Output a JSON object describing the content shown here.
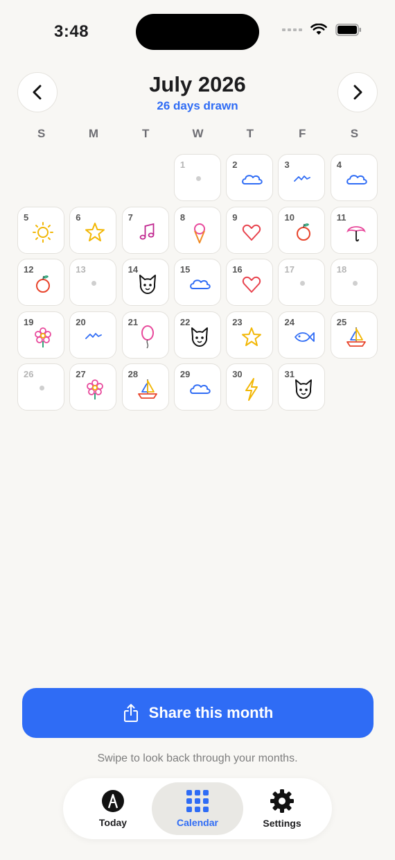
{
  "status": {
    "time": "3:48"
  },
  "header": {
    "title": "July 2026",
    "subtitle": "26 days drawn"
  },
  "weekdays": [
    "S",
    "M",
    "T",
    "W",
    "T",
    "F",
    "S"
  ],
  "calendar": {
    "leading_blanks": 3,
    "days": [
      {
        "n": "1",
        "d": ""
      },
      {
        "n": "2",
        "d": "cloud"
      },
      {
        "n": "3",
        "d": "bird"
      },
      {
        "n": "4",
        "d": "cloud"
      },
      {
        "n": "5",
        "d": "sun"
      },
      {
        "n": "6",
        "d": "star"
      },
      {
        "n": "7",
        "d": "music"
      },
      {
        "n": "8",
        "d": "icecream"
      },
      {
        "n": "9",
        "d": "heart"
      },
      {
        "n": "10",
        "d": "apple"
      },
      {
        "n": "11",
        "d": "umbrella"
      },
      {
        "n": "12",
        "d": "apple"
      },
      {
        "n": "13",
        "d": ""
      },
      {
        "n": "14",
        "d": "cat"
      },
      {
        "n": "15",
        "d": "cloud"
      },
      {
        "n": "16",
        "d": "heart"
      },
      {
        "n": "17",
        "d": ""
      },
      {
        "n": "18",
        "d": ""
      },
      {
        "n": "19",
        "d": "flower"
      },
      {
        "n": "20",
        "d": "bird"
      },
      {
        "n": "21",
        "d": "balloon"
      },
      {
        "n": "22",
        "d": "cat"
      },
      {
        "n": "23",
        "d": "star"
      },
      {
        "n": "24",
        "d": "fish"
      },
      {
        "n": "25",
        "d": "sailboat"
      },
      {
        "n": "26",
        "d": ""
      },
      {
        "n": "27",
        "d": "flower"
      },
      {
        "n": "28",
        "d": "sailboat"
      },
      {
        "n": "29",
        "d": "cloud"
      },
      {
        "n": "30",
        "d": "lightning"
      },
      {
        "n": "31",
        "d": "cat"
      }
    ]
  },
  "share": {
    "label": "Share this month"
  },
  "hint": "Swipe to look back through your months.",
  "tabs": {
    "today": "Today",
    "calendar": "Calendar",
    "settings": "Settings"
  },
  "colors": {
    "accent": "#2f6cf5",
    "background": "#f8f7f4"
  }
}
